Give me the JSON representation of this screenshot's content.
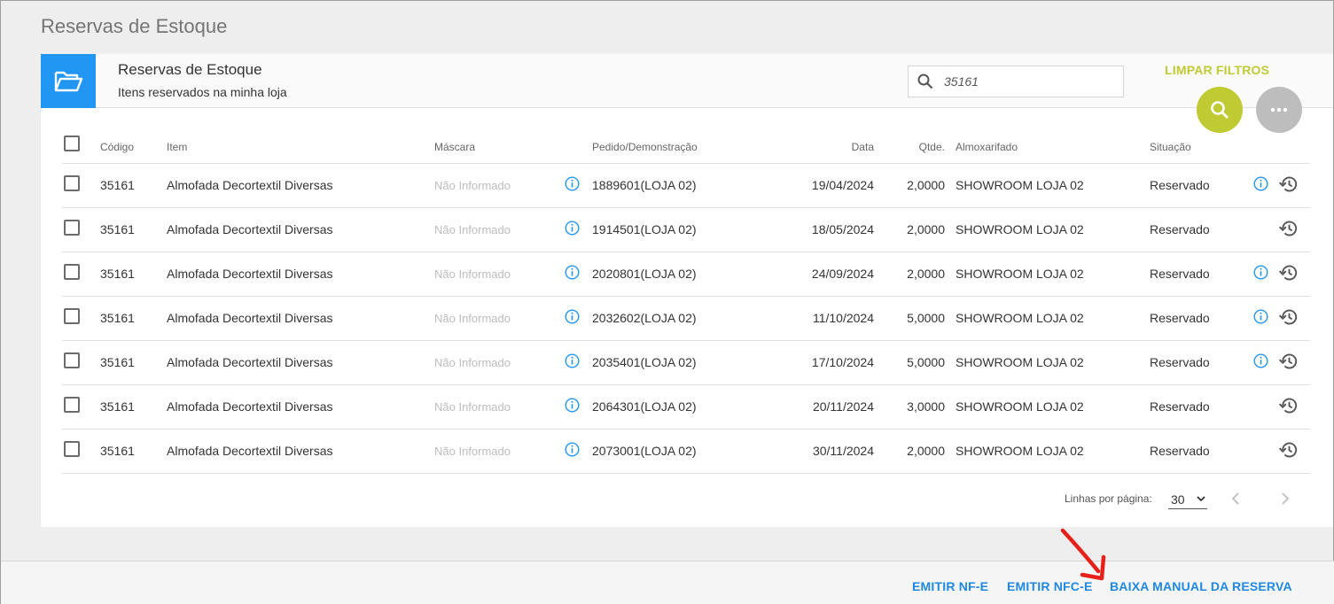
{
  "page": {
    "title": "Reservas de Estoque"
  },
  "header": {
    "title": "Reservas de Estoque",
    "subtitle": "Itens reservados na minha loja",
    "search_value": "35161",
    "clear_filters": "LIMPAR FILTROS",
    "folder_icon": "folder-open-icon",
    "search_icon": "search-icon",
    "more_icon": "more-horizontal-icon"
  },
  "table": {
    "columns": {
      "codigo": "Código",
      "item": "Item",
      "mascara": "Máscara",
      "pedido": "Pedido/Demonstração",
      "data": "Data",
      "qtde": "Qtde.",
      "almoxarifado": "Almoxarifado",
      "situacao": "Situação"
    },
    "rows": [
      {
        "codigo": "35161",
        "item": "Almofada Decortextil Diversas",
        "mascara": "Não Informado",
        "pedido": "1889601(LOJA 02)",
        "data": "19/04/2024",
        "qtde": "2,0000",
        "almoxarifado": "SHOWROOM LOJA 02",
        "situacao": "Reservado",
        "has_info": true
      },
      {
        "codigo": "35161",
        "item": "Almofada Decortextil Diversas",
        "mascara": "Não Informado",
        "pedido": "1914501(LOJA 02)",
        "data": "18/05/2024",
        "qtde": "2,0000",
        "almoxarifado": "SHOWROOM LOJA 02",
        "situacao": "Reservado",
        "has_info": false
      },
      {
        "codigo": "35161",
        "item": "Almofada Decortextil Diversas",
        "mascara": "Não Informado",
        "pedido": "2020801(LOJA 02)",
        "data": "24/09/2024",
        "qtde": "2,0000",
        "almoxarifado": "SHOWROOM LOJA 02",
        "situacao": "Reservado",
        "has_info": true
      },
      {
        "codigo": "35161",
        "item": "Almofada Decortextil Diversas",
        "mascara": "Não Informado",
        "pedido": "2032602(LOJA 02)",
        "data": "11/10/2024",
        "qtde": "5,0000",
        "almoxarifado": "SHOWROOM LOJA 02",
        "situacao": "Reservado",
        "has_info": true
      },
      {
        "codigo": "35161",
        "item": "Almofada Decortextil Diversas",
        "mascara": "Não Informado",
        "pedido": "2035401(LOJA 02)",
        "data": "17/10/2024",
        "qtde": "5,0000",
        "almoxarifado": "SHOWROOM LOJA 02",
        "situacao": "Reservado",
        "has_info": true
      },
      {
        "codigo": "35161",
        "item": "Almofada Decortextil Diversas",
        "mascara": "Não Informado",
        "pedido": "2064301(LOJA 02)",
        "data": "20/11/2024",
        "qtde": "3,0000",
        "almoxarifado": "SHOWROOM LOJA 02",
        "situacao": "Reservado",
        "has_info": false
      },
      {
        "codigo": "35161",
        "item": "Almofada Decortextil Diversas",
        "mascara": "Não Informado",
        "pedido": "2073001(LOJA 02)",
        "data": "30/11/2024",
        "qtde": "2,0000",
        "almoxarifado": "SHOWROOM LOJA 02",
        "situacao": "Reservado",
        "has_info": false
      }
    ]
  },
  "pagination": {
    "rows_per_page_label": "Linhas por página:",
    "rows_per_page_value": "30"
  },
  "actions": {
    "emitir_nfe": "EMITIR NF-E",
    "emitir_nfce": "EMITIR NFC-E",
    "baixa_manual": "BAIXA MANUAL DA RESERVA"
  },
  "colors": {
    "accent_blue": "#2196f3",
    "lime": "#c0ca33",
    "action_blue": "#1e88e5",
    "arrow_red": "#e8201a"
  }
}
